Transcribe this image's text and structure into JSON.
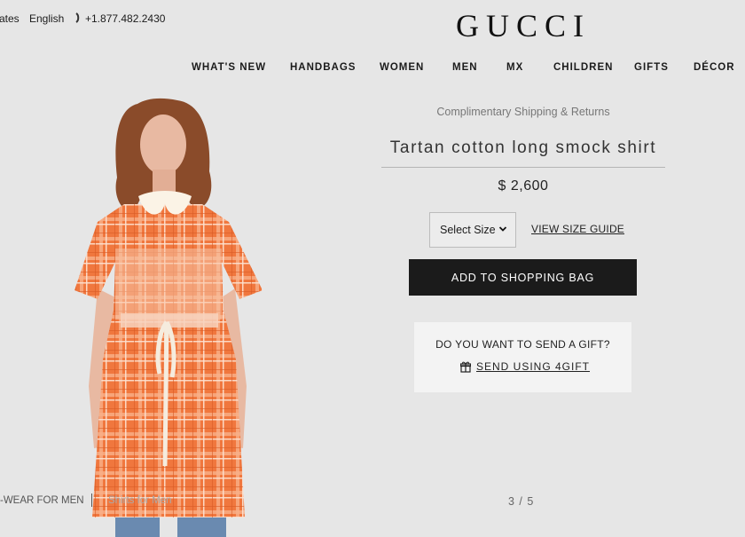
{
  "topbar": {
    "country": "ates",
    "language": "English",
    "phone": "+1.877.482.2430"
  },
  "brand": {
    "logo": "GUCCI"
  },
  "nav": {
    "items": [
      "WHAT'S NEW",
      "HANDBAGS",
      "WOMEN",
      "MEN",
      "MX",
      "CHILDREN",
      "GIFTS",
      "DÉCOR"
    ]
  },
  "product": {
    "shipping_note": "Complimentary Shipping & Returns",
    "title": "Tartan cotton long smock shirt",
    "price": "$ 2,600",
    "size_select": "Select Size",
    "size_guide": "VIEW SIZE GUIDE",
    "add_to_bag": "ADD TO SHOPPING BAG"
  },
  "gift": {
    "question": "DO YOU WANT TO SEND A GIFT?",
    "link": "SEND USING 4GIFT"
  },
  "gallery": {
    "breadcrumb": "-WEAR FOR MEN",
    "breadcrumb_next": "Shirts for Men",
    "pager": "3 / 5"
  },
  "colors": {
    "background": "#e6e6e6",
    "button": "#1b1b1b",
    "dress": "#f0773e"
  }
}
